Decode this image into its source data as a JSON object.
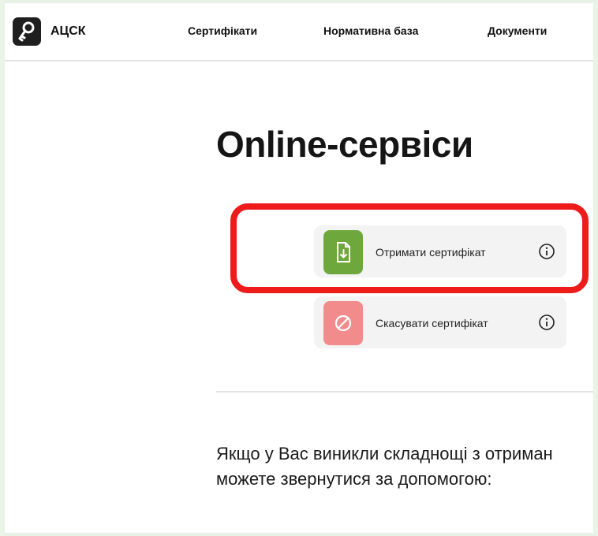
{
  "header": {
    "logo_text": "АЦСК",
    "nav": [
      {
        "label": "Сертифікати"
      },
      {
        "label": "Нормативна база"
      },
      {
        "label": "Документи"
      }
    ]
  },
  "main": {
    "title": "Online-сервіси",
    "services": [
      {
        "label": "Отримати сертифікат",
        "icon": "document-download-icon",
        "color": "#6ea83c",
        "highlighted": true
      },
      {
        "label": "Скасувати сертифікат",
        "icon": "cancel-icon",
        "color": "#f28c8c",
        "highlighted": false
      }
    ],
    "help_line_1": "Якщо у Вас виникли складнощі з отриман",
    "help_line_2": "можете звернутися за допомогою:"
  },
  "colors": {
    "highlight": "#ee1b1b",
    "frame": "#e9f3e6"
  }
}
